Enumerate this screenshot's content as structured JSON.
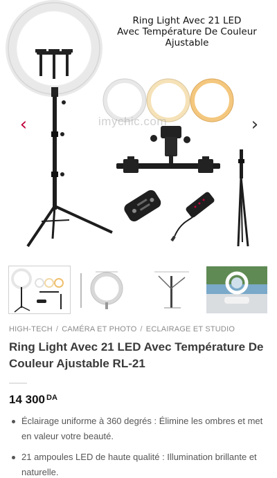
{
  "gallery": {
    "image_title_line1": "Ring Light Avec 21 LED",
    "image_title_line2": "Avec Température De Couleur",
    "image_title_line3": "Ajustable",
    "watermark": "imychic.com",
    "prev_icon": "chevron-left-icon",
    "next_icon": "chevron-right-icon",
    "prev_glyph": "‹",
    "next_glyph": "›",
    "arrow_prev_color": "#c0003a",
    "arrow_next_color": "#333333"
  },
  "breadcrumb": {
    "items": [
      "HIGH-TECH",
      "CAMÉRA ET PHOTO",
      "ECLAIRAGE ET STUDIO"
    ],
    "separator": "/"
  },
  "product": {
    "title": "Ring Light Avec 21 LED Avec Température De Couleur Ajustable RL-21",
    "price_value": "14 300",
    "price_currency": "DA",
    "features": [
      "Éclairage uniforme à 360 degrés : Élimine les ombres et met en valeur votre beauté.",
      "21 ampoules LED de haute qualité : Illumination brillante et naturelle."
    ]
  }
}
